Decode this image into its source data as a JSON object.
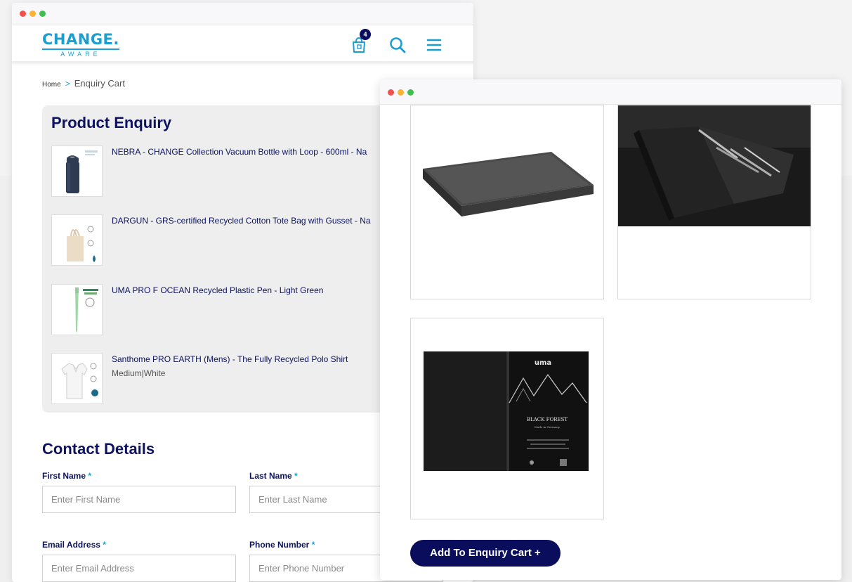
{
  "brand": {
    "logo_main": "CHANGE.",
    "logo_sub": "AWARE",
    "accent_color": "#1b9fd1",
    "navy_color": "#0a0d5c"
  },
  "header": {
    "cart_count": "4",
    "icons": [
      "bag-icon",
      "search-icon",
      "menu-icon"
    ]
  },
  "breadcrumb": {
    "home": "Home",
    "separator": ">",
    "current": "Enquiry Cart"
  },
  "enquiry": {
    "title": "Product Enquiry",
    "items": [
      {
        "name": "NEBRA - CHANGE Collection Vacuum Bottle with Loop - 600ml - Na",
        "variant": ""
      },
      {
        "name": "DARGUN - GRS-certified Recycled Cotton Tote Bag with Gusset - Na",
        "variant": ""
      },
      {
        "name": "UMA PRO F OCEAN Recycled Plastic Pen - Light Green",
        "variant": ""
      },
      {
        "name": "Santhome PRO EARTH (Mens) - The Fully Recycled Polo Shirt",
        "variant": "Medium|White"
      }
    ]
  },
  "contact": {
    "title": "Contact Details",
    "required_mark": "*",
    "first_name": {
      "label": "First Name",
      "placeholder": "Enter First Name"
    },
    "last_name": {
      "label": "Last Name",
      "placeholder": "Enter Last Name"
    },
    "email": {
      "label": "Email Address",
      "placeholder": "Enter Email Address"
    },
    "phone": {
      "label": "Phone Number",
      "placeholder": "Enter Phone Number"
    }
  },
  "gallery": {
    "notebook_brand": "uma",
    "notebook_title": "BLACK FOREST",
    "notebook_subtitle": "Made in Germany",
    "add_button": "Add To Enquiry Cart +"
  }
}
